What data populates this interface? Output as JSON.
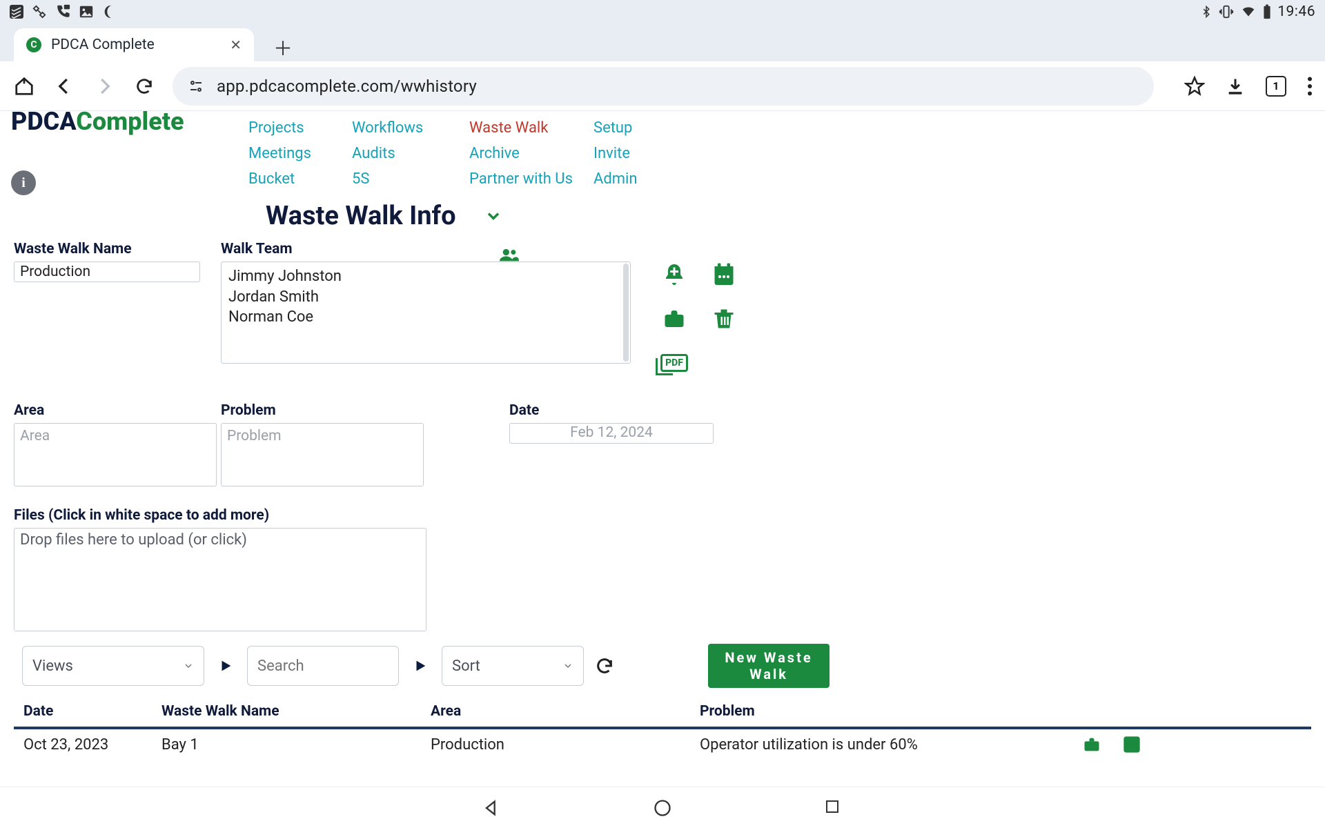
{
  "status": {
    "time": "19:46"
  },
  "browser": {
    "tab_title": "PDCA Complete",
    "tab_count": "1",
    "url": "app.pdcacomplete.com/wwhistory"
  },
  "logo": {
    "a": "PDCA",
    "b": "Complete"
  },
  "nav": {
    "projects": "Projects",
    "workflows": "Workflows",
    "wastewalk": "Waste Walk",
    "setup": "Setup",
    "meetings": "Meetings",
    "audits": "Audits",
    "archive": "Archive",
    "invite": "Invite",
    "bucket": "Bucket",
    "fives": "5S",
    "partner": "Partner with Us",
    "admin": "Admin"
  },
  "section": {
    "title": "Waste Walk Info"
  },
  "labels": {
    "name": "Waste Walk Name",
    "team": "Walk Team",
    "area": "Area",
    "problem": "Problem",
    "date": "Date",
    "files": "Files (Click in white space to add more)"
  },
  "form": {
    "name_value": "Production",
    "team_members": [
      "Jimmy Johnston",
      "Jordan Smith",
      "Norman Coe"
    ],
    "area_placeholder": "Area",
    "problem_placeholder": "Problem",
    "date_value": "Feb 12, 2024",
    "files_placeholder": "Drop files here to upload (or click)"
  },
  "controls": {
    "views": "Views",
    "search_placeholder": "Search",
    "sort": "Sort",
    "new_button_l1": "New Waste",
    "new_button_l2": "Walk"
  },
  "table": {
    "headers": {
      "date": "Date",
      "name": "Waste Walk Name",
      "area": "Area",
      "problem": "Problem"
    },
    "rows": [
      {
        "date": "Oct 23, 2023",
        "name": "Bay 1",
        "area": "Production",
        "problem": "Operator utilization is under 60%"
      }
    ]
  },
  "colors": {
    "accent": "#1b8a3e",
    "link": "#17a2b8",
    "active": "#c0392b",
    "heading": "#101a3a"
  }
}
